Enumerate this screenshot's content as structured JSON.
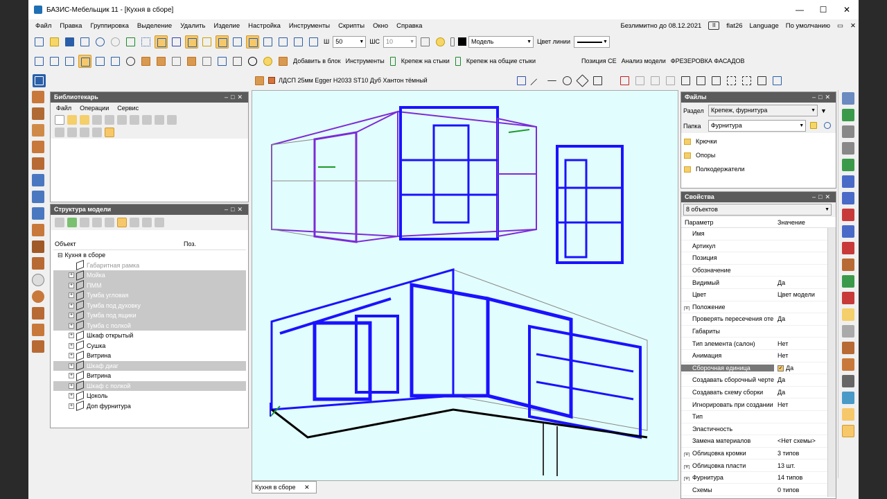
{
  "window": {
    "title": "БАЗИС-Мебельщик 11 - [Кухня в сборе]",
    "minimize": "—",
    "maximize": "☐",
    "close": "✕"
  },
  "menu": {
    "items": [
      "Файл",
      "Правка",
      "Группировка",
      "Выделение",
      "Удалить",
      "Изделие",
      "Настройка",
      "Инструменты",
      "Скрипты",
      "Окно",
      "Справка"
    ],
    "license": "Безлимитно до 08.12.2021",
    "pause": "II",
    "user": "flat26",
    "language": "Language",
    "default": "По умолчанию",
    "restore": "▭",
    "close": "✕"
  },
  "toolbar1": {
    "w_label": "Ш",
    "w_value": "50",
    "shs_label": "ШС",
    "shs_value": "10",
    "layer_value": "Модель",
    "line_color_label": "Цвет линии"
  },
  "toolbar2": {
    "add_to_block": "Добавить в блок",
    "tools": "Инструменты",
    "fastening_ends": "Крепеж на стыки",
    "fastening_common": "Крепеж на общие стыки",
    "position_se": "Позиция СЕ",
    "model_analysis": "Анализ модели",
    "facade_milling": "ФРЕЗЕРОВКА ФАСАДОВ"
  },
  "material": "ЛДСП 25мм Egger H2033 ST10 Дуб Хантон тёмный",
  "librarian": {
    "title": "Библиотекарь",
    "menu": [
      "Файл",
      "Операции",
      "Сервис"
    ]
  },
  "structure": {
    "title": "Структура модели",
    "col_object": "Объект",
    "col_pos": "Поз.",
    "root": "Кухня в сборе",
    "items": [
      {
        "label": "Габаритная рамка",
        "state": "gray"
      },
      {
        "label": "Мойка",
        "state": "sel"
      },
      {
        "label": "ПММ",
        "state": "sel"
      },
      {
        "label": "Тумба угловая",
        "state": "sel"
      },
      {
        "label": "Тумба под духовку",
        "state": "sel"
      },
      {
        "label": "Тумба под ящики",
        "state": "sel"
      },
      {
        "label": "Тумба с полкой",
        "state": "sel"
      },
      {
        "label": "Шкаф открытый",
        "state": "normal"
      },
      {
        "label": "Сушка",
        "state": "normal"
      },
      {
        "label": "Витрина",
        "state": "normal"
      },
      {
        "label": "Шкаф диаг",
        "state": "sel"
      },
      {
        "label": "Витрина",
        "state": "normal"
      },
      {
        "label": "Шкаф с полкой",
        "state": "sel"
      },
      {
        "label": "Цоколь",
        "state": "normal"
      },
      {
        "label": "Доп фурнитура",
        "state": "normal"
      }
    ]
  },
  "files": {
    "title": "Файлы",
    "section_label": "Раздел",
    "section_value": "Крепеж, фурнитура",
    "folder_label": "Папка",
    "folder_value": "Фурнитура",
    "list": [
      "Крючки",
      "Опоры",
      "Полкодержатели"
    ]
  },
  "properties": {
    "title": "Свойства",
    "selection": "8 объектов",
    "col_param": "Параметр",
    "col_value": "Значение",
    "rows": [
      {
        "name": "Имя",
        "value": "",
        "exp": ""
      },
      {
        "name": "Артикул",
        "value": "",
        "exp": ""
      },
      {
        "name": "Позиция",
        "value": "",
        "exp": ""
      },
      {
        "name": "Обозначение",
        "value": "",
        "exp": ""
      },
      {
        "name": "Видимый",
        "value": "Да",
        "exp": ""
      },
      {
        "name": "Цвет",
        "value": "Цвет модели",
        "exp": ""
      },
      {
        "name": "Положение",
        "value": "",
        "exp": "+"
      },
      {
        "name": "Проверять пересечения оте",
        "value": "Да",
        "exp": ""
      },
      {
        "name": "Габариты",
        "value": "",
        "exp": ""
      },
      {
        "name": "Тип элемента (салон)",
        "value": "Нет",
        "exp": ""
      },
      {
        "name": "Анимация",
        "value": "Нет",
        "exp": ""
      },
      {
        "name": "Сборочная единица",
        "value": "Да",
        "exp": "",
        "sel": true
      },
      {
        "name": "Создавать сборочный черте",
        "value": "Да",
        "exp": ""
      },
      {
        "name": "Создавать схему сборки",
        "value": "Да",
        "exp": ""
      },
      {
        "name": "Игнорировать при создании",
        "value": "Нет",
        "exp": ""
      },
      {
        "name": "Тип",
        "value": "",
        "exp": ""
      },
      {
        "name": "Эластичность",
        "value": "",
        "exp": ""
      },
      {
        "name": "Замена материалов",
        "value": "<Нет схемы>",
        "exp": ""
      },
      {
        "name": "Облицовка кромки",
        "value": "3 типов",
        "exp": "+"
      },
      {
        "name": "Облицовка пласти",
        "value": "13 шт.",
        "exp": "+"
      },
      {
        "name": "Фурнитура",
        "value": "14 типов",
        "exp": "+"
      },
      {
        "name": "Схемы",
        "value": "0 типов",
        "exp": ""
      }
    ]
  },
  "doc_tab": {
    "label": "Кухня в сборе",
    "close": "✕"
  }
}
